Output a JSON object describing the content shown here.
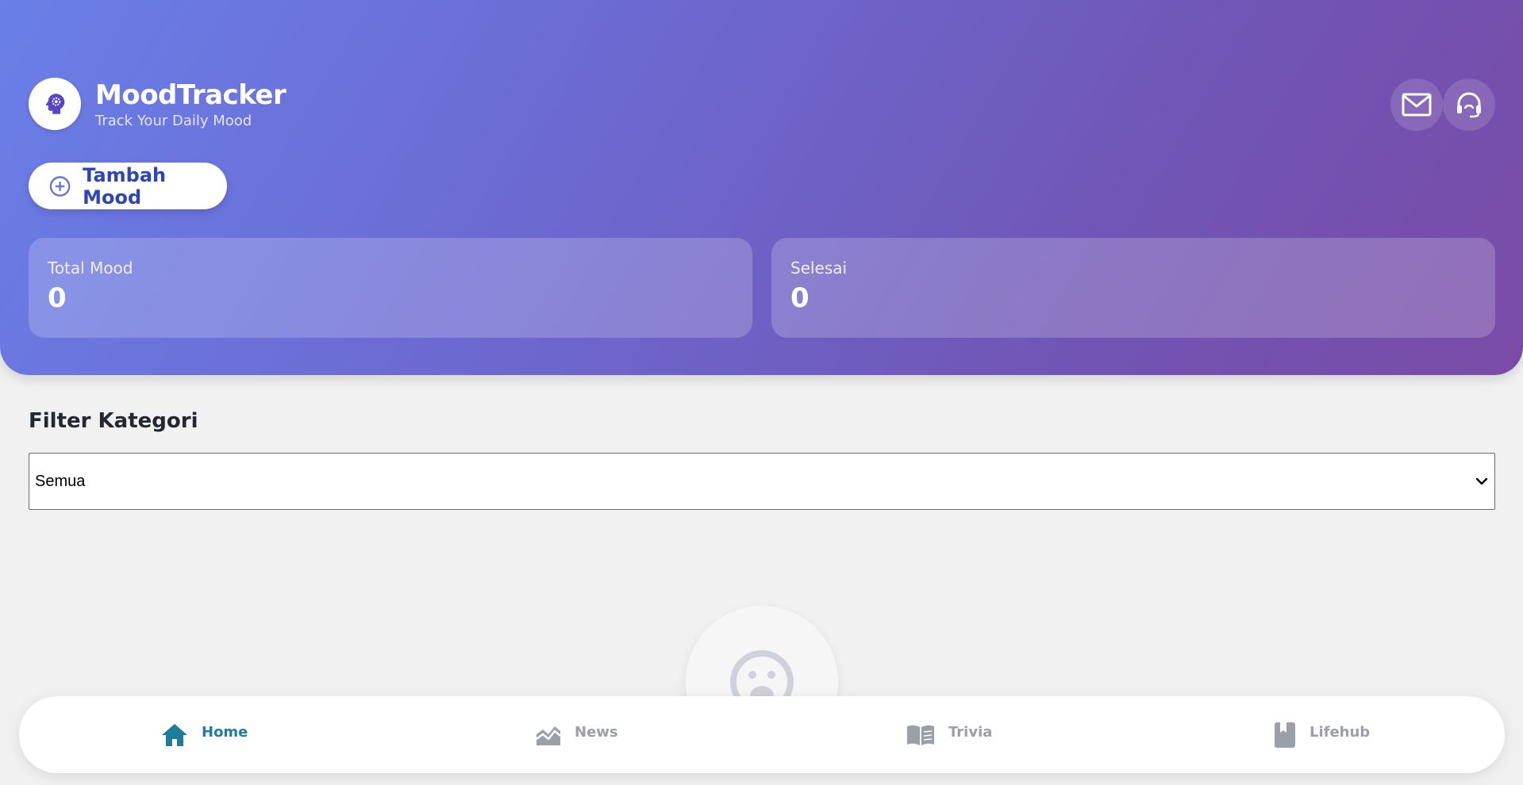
{
  "app": {
    "title": "MoodTracker",
    "subtitle": "Track Your Daily Mood",
    "logo_icon": "brain-gear-icon"
  },
  "header_actions": [
    {
      "icon": "mail-icon"
    },
    {
      "icon": "headset-icon"
    }
  ],
  "add_button": {
    "label": "Tambah Mood",
    "icon": "plus-circle-icon"
  },
  "stats": {
    "total": {
      "label": "Total Mood",
      "value": "0"
    },
    "done": {
      "label": "Selesai",
      "value": "0"
    }
  },
  "filter": {
    "title": "Filter Kategori",
    "selected": "Semua"
  },
  "empty_state": {
    "icon": "sad-face-icon"
  },
  "nav": {
    "items": [
      {
        "label": "Home",
        "icon": "home-icon",
        "active": true
      },
      {
        "label": "News",
        "icon": "chart-area-icon",
        "active": false
      },
      {
        "label": "Trivia",
        "icon": "book-open-icon",
        "active": false
      },
      {
        "label": "Lifehub",
        "icon": "book-bookmark-icon",
        "active": false
      }
    ]
  },
  "colors": {
    "header_gradient_start": "#6a7fe8",
    "header_gradient_end": "#7a4ba6",
    "accent_blue": "#2c45b8",
    "nav_active": "#1c7e9c",
    "nav_inactive": "#9aa0a8",
    "background": "#f1f1f1"
  }
}
